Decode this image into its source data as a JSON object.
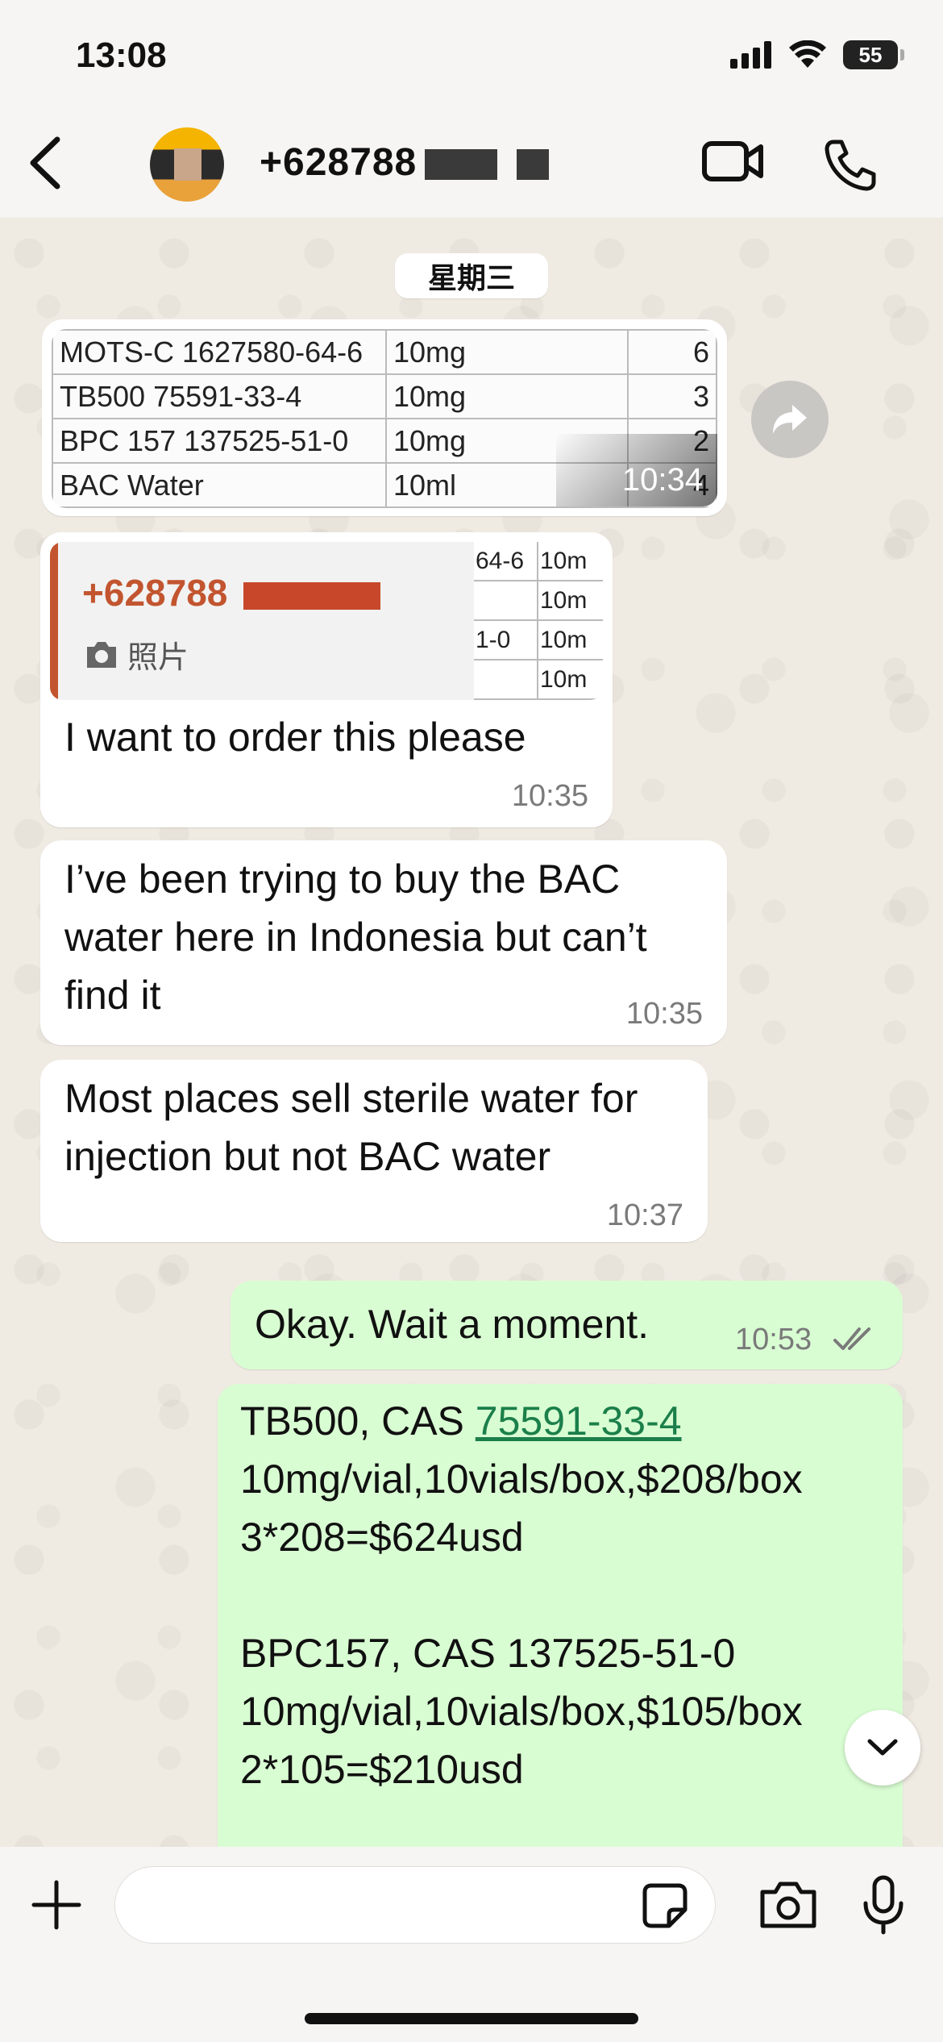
{
  "status_bar": {
    "time": "13:08",
    "battery": "55"
  },
  "header": {
    "contact_name": "+628788",
    "avatar_icon": "avatar-image"
  },
  "day_label": "星期三",
  "image_message": {
    "rows": [
      {
        "name": "MOTS-C 1627580-64-6",
        "dose": "10mg",
        "qty": "6"
      },
      {
        "name": "TB500 75591-33-4",
        "dose": "10mg",
        "qty": "3"
      },
      {
        "name": "BPC 157 137525-51-0",
        "dose": "10mg",
        "qty": "2"
      },
      {
        "name": "BAC Water",
        "dose": "10ml",
        "qty": "4"
      }
    ],
    "time": "10:34"
  },
  "reply_message": {
    "quoted_name": "+628788",
    "quoted_media_label": "照片",
    "quoted_thumb": [
      [
        "64-6",
        "10m"
      ],
      [
        "",
        "10m"
      ],
      [
        "1-0",
        "10m"
      ],
      [
        "",
        "10m"
      ]
    ],
    "text": "I want to order this please",
    "time": "10:35"
  },
  "messages_in": [
    {
      "text": "I’ve been trying to buy the BAC water here in Indonesia but can’t find it",
      "time": "10:35"
    },
    {
      "text": "Most places sell sterile water for injection but not BAC water",
      "time": "10:37"
    }
  ],
  "messages_out": [
    {
      "text": "Okay. Wait a moment.",
      "time": "10:53"
    }
  ],
  "quote_message": {
    "line1_prefix": "TB500, CAS ",
    "line1_link": "75591-33-4",
    "line2": "10mg/vial,10vials/box,$208/box",
    "line3": "3*208=$624usd",
    "line4": "BPC157, CAS 137525-51-0",
    "line5": "10mg/vial,10vials/box,$105/box",
    "line6": "2*105=$210usd"
  },
  "colors": {
    "incoming_bubble": "#ffffff",
    "outgoing_bubble": "#d9fdd3",
    "quote_accent": "#c2552f",
    "link": "#1b7f4a",
    "background": "#efeae2"
  }
}
